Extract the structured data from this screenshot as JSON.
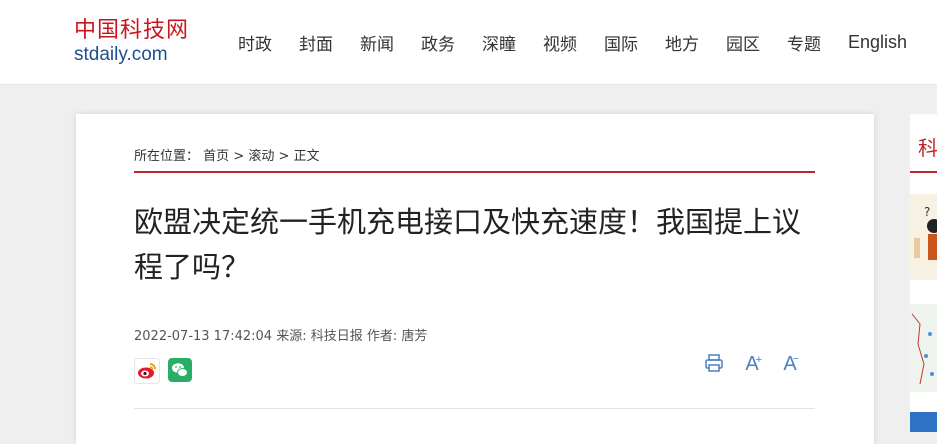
{
  "header": {
    "logo_cn": "中国科技网",
    "logo_en": "stdaily.com",
    "nav": [
      "时政",
      "封面",
      "新闻",
      "政务",
      "深瞳",
      "视频",
      "国际",
      "地方",
      "园区",
      "专题",
      "English"
    ]
  },
  "article": {
    "breadcrumb": {
      "prefix": "所在位置：",
      "home": "首页",
      "sep1": " > ",
      "section": "滚动",
      "sep2": " > ",
      "current": "正文"
    },
    "title": "欧盟决定统一手机充电接口及快充速度！我国提上议程了吗？",
    "meta": "2022-07-13 17:42:04 来源: 科技日报 作者: 唐芳",
    "share": [
      "weibo-icon",
      "wechat-icon"
    ],
    "tools": {
      "print": "print-icon",
      "font_larger": "A",
      "font_smaller": "A"
    }
  },
  "sidebar": {
    "title": "科"
  },
  "colors": {
    "brand_red": "#b8282e",
    "link_blue": "#4a7fc1",
    "logo_blue": "#1d4f91"
  }
}
